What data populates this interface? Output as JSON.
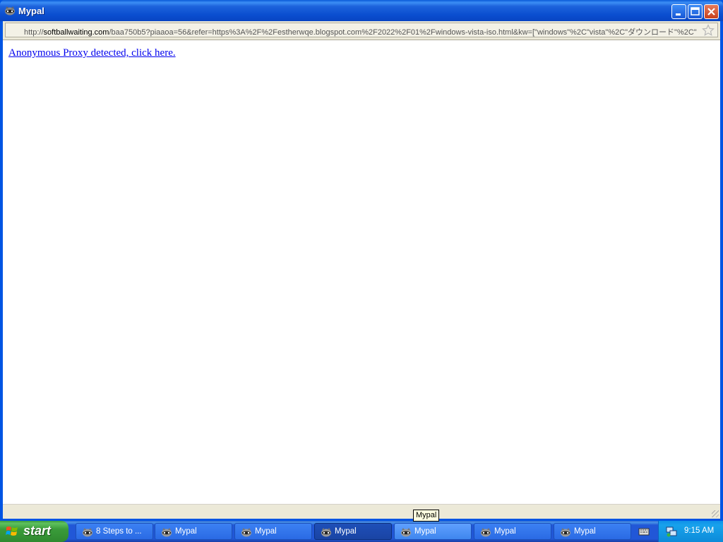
{
  "window": {
    "title": "Mypal",
    "icon": "raccoon-icon",
    "url_prefix": "http://",
    "url_host": "softballwaiting.com",
    "url_rest": "/baa750b5?piaaoa=56&refer=https%3A%2F%2Festherwqe.blogspot.com%2F2022%2F01%2Fwindows-vista-iso.html&kw=[\"windows\"%2C\"vista\"%2C\"ダウンロード\"%2C\""
  },
  "content": {
    "link_text": "Anonymous Proxy detected, click here."
  },
  "tooltip": "Mypal",
  "taskbar": {
    "start_label": "start",
    "tasks": [
      {
        "label": "8 Steps to ...",
        "state": "normal"
      },
      {
        "label": "Mypal",
        "state": "normal"
      },
      {
        "label": "Mypal",
        "state": "normal"
      },
      {
        "label": "Mypal",
        "state": "active"
      },
      {
        "label": "Mypal",
        "state": "hover"
      },
      {
        "label": "Mypal",
        "state": "normal"
      },
      {
        "label": "Mypal",
        "state": "normal"
      }
    ],
    "clock": "9:15 AM"
  },
  "colors": {
    "titlebar": "#0a4ed0",
    "taskbar": "#2157d7",
    "start": "#3a9b3a",
    "link": "#0000ee"
  }
}
